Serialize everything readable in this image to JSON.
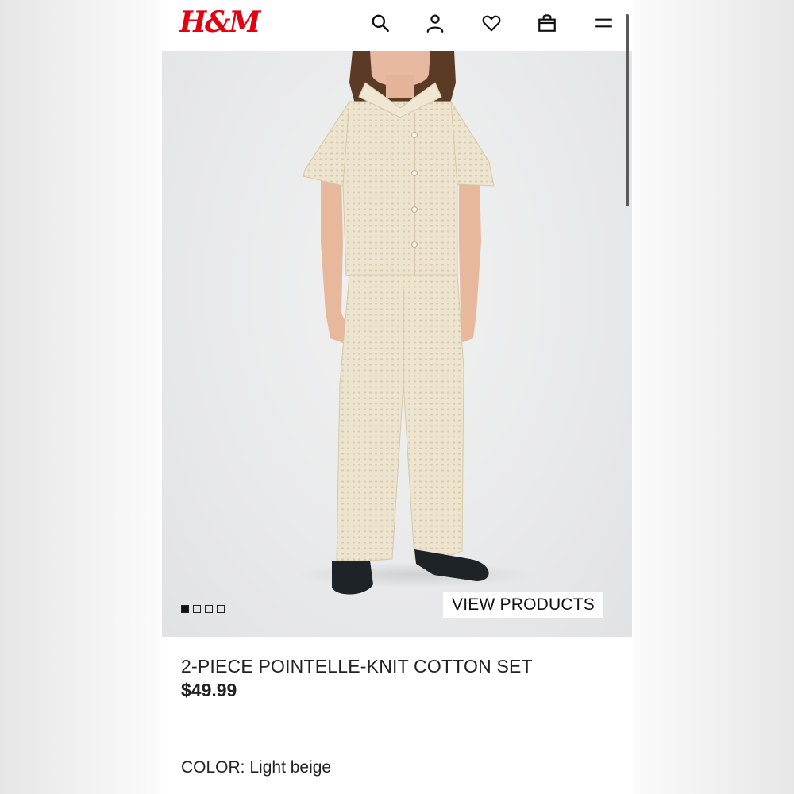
{
  "header": {
    "logo_text": "H&M",
    "brand_color": "#e50010",
    "icons": [
      "search-icon",
      "account-icon",
      "heart-icon",
      "shopping-bag-icon",
      "menu-icon"
    ]
  },
  "hero": {
    "image_subject": "child wearing light beige crochet shirt and pants with black shoes",
    "carousel_total": 4,
    "carousel_active": 1,
    "view_products_label": "VIEW PRODUCTS"
  },
  "product": {
    "title": "2-PIECE POINTELLE-KNIT COTTON SET",
    "price": "$49.99",
    "color_label": "COLOR:",
    "color_value": "Light beige",
    "swatch_color": "#ede4cf"
  }
}
